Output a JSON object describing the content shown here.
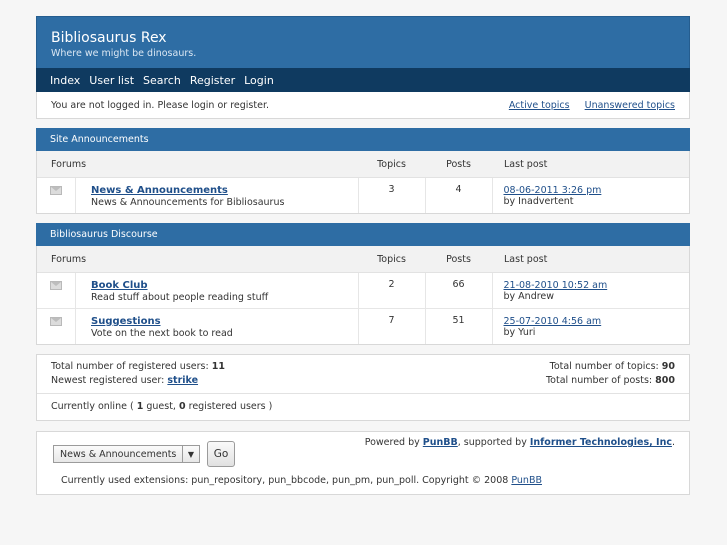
{
  "brand": {
    "title": "Bibliosaurus Rex",
    "description": "Where we might be dinosaurs."
  },
  "nav": {
    "items": [
      "Index",
      "User list",
      "Search",
      "Register",
      "Login"
    ]
  },
  "status": {
    "message": "You are not logged in. Please login or register.",
    "active_topics": "Active topics",
    "unanswered_topics": "Unanswered topics"
  },
  "categories": [
    {
      "name": "Site Announcements",
      "headers": {
        "forums": "Forums",
        "topics": "Topics",
        "posts": "Posts",
        "last_post": "Last post"
      },
      "forums": [
        {
          "name": "News & Announcements",
          "desc": "News & Announcements for Bibliosaurus",
          "topics": "3",
          "posts": "4",
          "last_post": "08-06-2011 3:26 pm",
          "by": "by Inadvertent"
        }
      ]
    },
    {
      "name": "Bibliosaurus Discourse",
      "headers": {
        "forums": "Forums",
        "topics": "Topics",
        "posts": "Posts",
        "last_post": "Last post"
      },
      "forums": [
        {
          "name": "Book Club",
          "desc": "Read stuff about people reading stuff",
          "topics": "2",
          "posts": "66",
          "last_post": "21-08-2010 10:52 am",
          "by": "by Andrew"
        },
        {
          "name": "Suggestions",
          "desc": "Vote on the next book to read",
          "topics": "7",
          "posts": "51",
          "last_post": "25-07-2010 4:56 am",
          "by": "by Yuri"
        }
      ]
    }
  ],
  "stats": {
    "registered_label": "Total number of registered users:",
    "registered_value": "11",
    "newest_label": "Newest registered user:",
    "newest_value": "strike",
    "topics_label": "Total number of topics:",
    "topics_value": "90",
    "posts_label": "Total number of posts:",
    "posts_value": "800",
    "online_prefix": "Currently online (",
    "guests": "1",
    "guest_label": "guest,",
    "registered_online": "0",
    "registered_online_label": "registered users )"
  },
  "footer": {
    "jump_value": "News & Announcements",
    "go": "Go",
    "powered_prefix": "Powered by",
    "punbb": "PunBB",
    "supported_by": ", supported by",
    "informer": "Informer Technologies, Inc",
    "period": ".",
    "extensions": "Currently used extensions: pun_repository, pun_bbcode, pun_pm, pun_poll. Copyright © 2008",
    "punbb_link": "PunBB"
  },
  "icons": {
    "forum": "envelope-icon",
    "dropdown": "chevron-down-icon"
  },
  "colors": {
    "brand": "#2e6da4",
    "nav": "#0f3a60",
    "link": "#1f4f8a"
  }
}
